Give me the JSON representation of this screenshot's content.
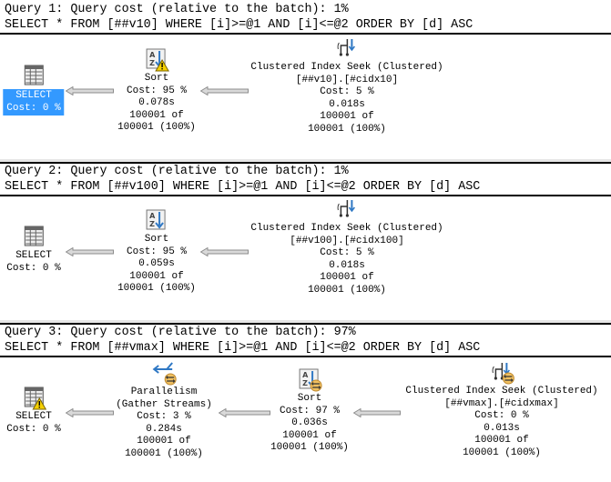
{
  "colors": {
    "selection": "#3399ff",
    "arrow_fill": "#d9d9d9",
    "arrow_stroke": "#8c8c8c",
    "warning": "#f5d000",
    "parallel_badge": "#f0c060",
    "icon_blue": "#2f78c4"
  },
  "queries": [
    {
      "header": "Query 1: Query cost (relative to the batch): 1%",
      "sql": "SELECT * FROM [##v10] WHERE [i]>=@1 AND [i]<=@2 ORDER BY [d] ASC",
      "nodes": [
        {
          "icon": "select-table-icon",
          "selected": true,
          "warning": false,
          "parallel": false,
          "lines": [
            "SELECT",
            "Cost: 0 %"
          ]
        },
        {
          "icon": "sort-icon",
          "selected": false,
          "warning": true,
          "parallel": false,
          "lines": [
            "Sort",
            "Cost: 95 %",
            "0.078s",
            "100001 of",
            "100001 (100%)"
          ]
        },
        {
          "icon": "clustered-index-seek-icon",
          "selected": false,
          "warning": false,
          "parallel": false,
          "lines": [
            "Clustered Index Seek (Clustered)",
            "[##v10].[#cidx10]",
            "Cost: 5 %",
            "0.018s",
            "100001 of",
            "100001 (100%)"
          ]
        }
      ]
    },
    {
      "header": "Query 2: Query cost (relative to the batch): 1%",
      "sql": "SELECT * FROM [##v100] WHERE [i]>=@1 AND [i]<=@2 ORDER BY [d] ASC",
      "nodes": [
        {
          "icon": "select-table-icon",
          "selected": false,
          "warning": false,
          "parallel": false,
          "lines": [
            "SELECT",
            "Cost: 0 %"
          ]
        },
        {
          "icon": "sort-icon",
          "selected": false,
          "warning": false,
          "parallel": false,
          "lines": [
            "Sort",
            "Cost: 95 %",
            "0.059s",
            "100001 of",
            "100001 (100%)"
          ]
        },
        {
          "icon": "clustered-index-seek-icon",
          "selected": false,
          "warning": false,
          "parallel": false,
          "lines": [
            "Clustered Index Seek (Clustered)",
            "[##v100].[#cidx100]",
            "Cost: 5 %",
            "0.018s",
            "100001 of",
            "100001 (100%)"
          ]
        }
      ]
    },
    {
      "header": "Query 3: Query cost (relative to the batch): 97%",
      "sql": "SELECT * FROM [##vmax] WHERE [i]>=@1 AND [i]<=@2 ORDER BY [d] ASC",
      "nodes": [
        {
          "icon": "select-table-icon",
          "selected": false,
          "warning": true,
          "parallel": false,
          "lines": [
            "SELECT",
            "Cost: 0 %"
          ]
        },
        {
          "icon": "parallelism-icon",
          "selected": false,
          "warning": false,
          "parallel": true,
          "lines": [
            "Parallelism",
            "(Gather Streams)",
            "Cost: 3 %",
            "0.284s",
            "100001 of",
            "100001 (100%)"
          ]
        },
        {
          "icon": "sort-icon",
          "selected": false,
          "warning": false,
          "parallel": true,
          "lines": [
            "Sort",
            "Cost: 97 %",
            "0.036s",
            "100001 of",
            "100001 (100%)"
          ]
        },
        {
          "icon": "clustered-index-seek-icon",
          "selected": false,
          "warning": false,
          "parallel": true,
          "lines": [
            "Clustered Index Seek (Clustered)",
            "[##vmax].[#cidxmax]",
            "Cost: 0 %",
            "0.013s",
            "100001 of",
            "100001 (100%)"
          ]
        }
      ]
    }
  ]
}
